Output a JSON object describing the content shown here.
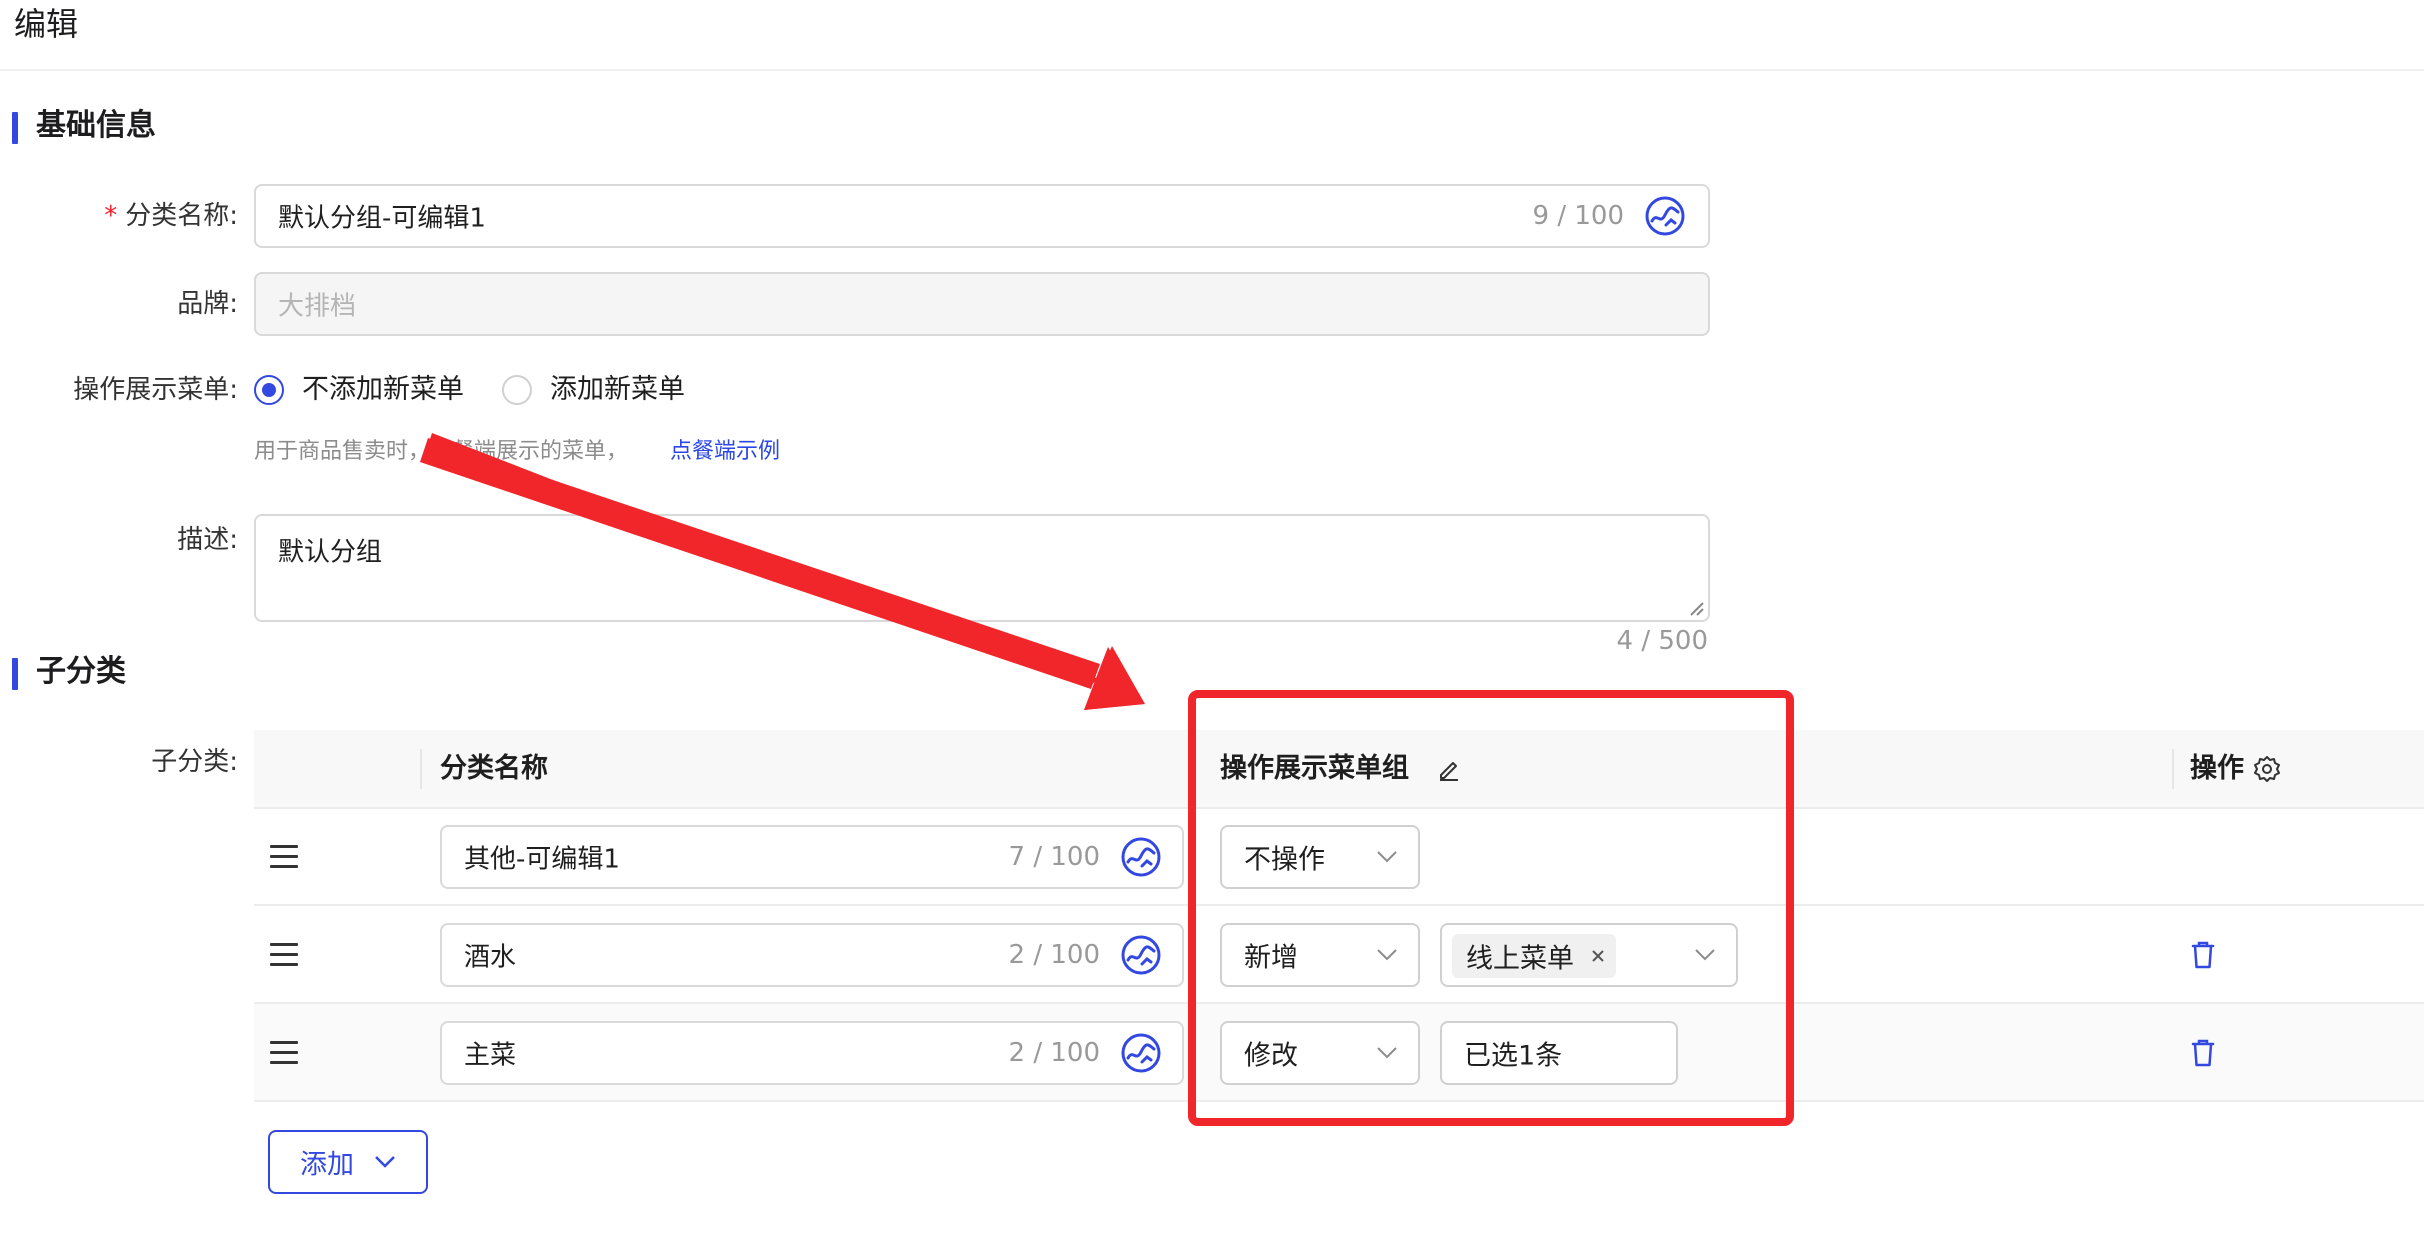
{
  "page": {
    "title": "编辑"
  },
  "basic_section": {
    "title": "基础信息",
    "category_name": {
      "required_mark": "*",
      "label": "分类名称:",
      "value": "默认分组-可编辑1",
      "counter": "9 / 100",
      "ai_icon": "ai-assist-icon"
    },
    "brand": {
      "label": "品牌:",
      "placeholder": "大排档",
      "disabled": true
    },
    "menu_display": {
      "label": "操作展示菜单:",
      "options": [
        {
          "label": "不添加新菜单",
          "checked": true
        },
        {
          "label": "添加新菜单",
          "checked": false
        }
      ],
      "help_text": "用于商品售卖时，点餐端展示的菜单，",
      "help_link": "点餐端示例"
    },
    "description": {
      "label": "描述:",
      "value": "默认分组",
      "counter": "4 / 500"
    }
  },
  "sub_section": {
    "title": "子分类",
    "field_label": "子分类:",
    "table": {
      "headers": {
        "name": "分类名称",
        "menu_group": "操作展示菜单组",
        "action": "操作"
      },
      "rows": [
        {
          "name": "其他-可编辑1",
          "counter": "7 / 100",
          "operation": "不操作",
          "menu": null,
          "deletable": false
        },
        {
          "name": "酒水",
          "counter": "2 / 100",
          "operation": "新增",
          "menu": {
            "type": "tags",
            "tags": [
              "线上菜单"
            ]
          },
          "deletable": true
        },
        {
          "name": "主菜",
          "counter": "2 / 100",
          "operation": "修改",
          "menu": {
            "type": "text",
            "text": "已选1条"
          },
          "deletable": true
        }
      ]
    },
    "add_button": "添加"
  },
  "annotation": {
    "color": "#f0262a",
    "icons": [
      "arrow-annotation",
      "highlight-box"
    ]
  },
  "colors": {
    "primary": "#3348e0",
    "required": "#f5222d",
    "annotation": "#f0262a"
  }
}
